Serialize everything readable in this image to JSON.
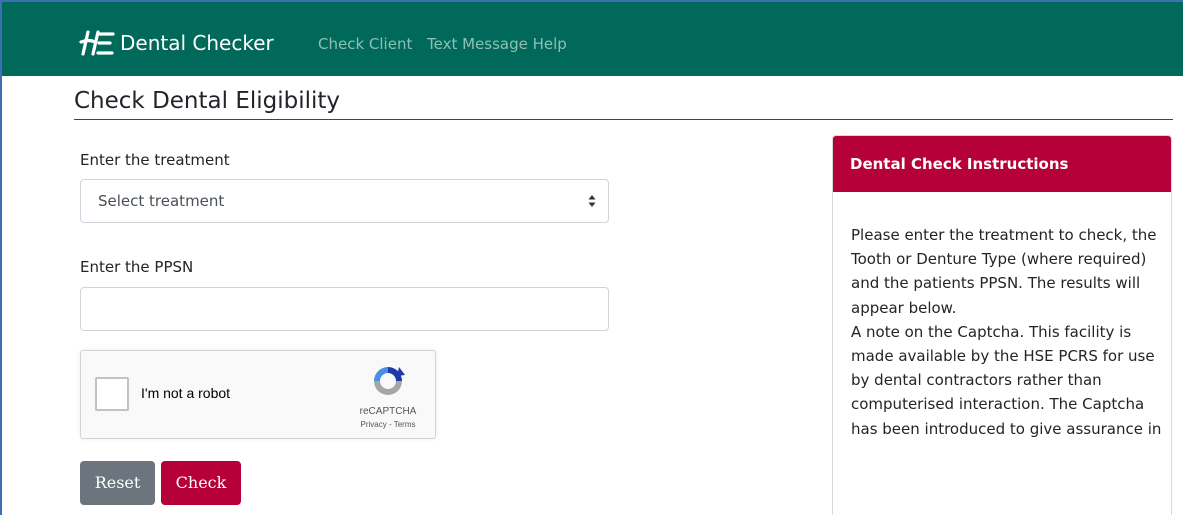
{
  "navbar": {
    "brand_name": "Dental Checker",
    "links": [
      {
        "label": "Check Client"
      },
      {
        "label": "Text Message Help"
      }
    ],
    "background": "#00695a"
  },
  "page": {
    "title": "Check Dental Eligibility"
  },
  "form": {
    "treatment_label": "Enter the treatment",
    "treatment_select_value": "Select treatment",
    "ppsn_label": "Enter the PPSN",
    "ppsn_value": "",
    "captcha": {
      "label": "I'm not a robot",
      "brand": "reCAPTCHA",
      "links": "Privacy - Terms"
    },
    "reset_label": "Reset",
    "check_label": "Check"
  },
  "panel": {
    "title": "Dental Check Instructions",
    "paragraph1": "Please enter the treatment to check, the Tooth or Denture Type (where required) and the patients PPSN. The results will appear below.",
    "paragraph2": "A note on the Captcha. This facility is made available by the HSE PCRS for use by dental contractors rather than computerised interaction. The Captcha has been introduced to give assurance in"
  },
  "colors": {
    "accent_crimson": "#b5003a",
    "button_grey": "#6c757d",
    "nav_green": "#00695a"
  }
}
